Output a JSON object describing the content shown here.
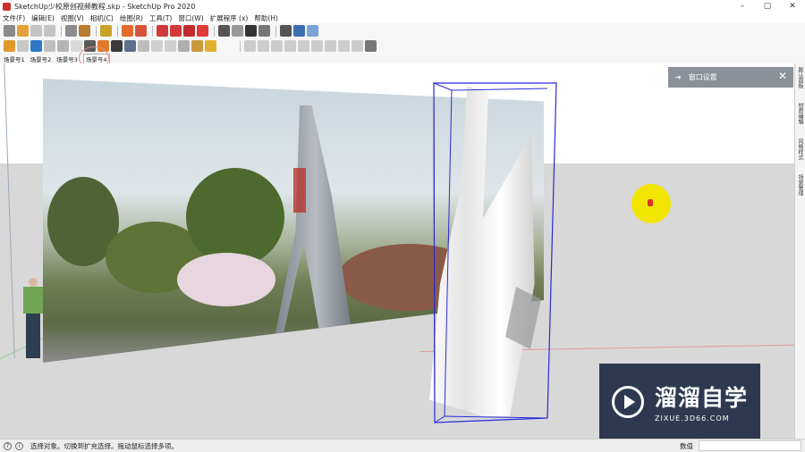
{
  "window": {
    "title": "SketchUp少校原创视频教程.skp - SketchUp Pro 2020",
    "minimize": "–",
    "maximize": "▢",
    "close": "✕"
  },
  "menu": [
    "文件(F)",
    "编辑(E)",
    "视图(V)",
    "相机(C)",
    "绘图(R)",
    "工具(T)",
    "窗口(W)",
    "扩展程序 (x)",
    "帮助(H)"
  ],
  "scene_tabs": [
    "场景号1",
    "场景号2",
    "场景号3",
    "场景号4"
  ],
  "active_tab": "场景号4",
  "tray": {
    "title": "窗口设置",
    "arrow": "➜",
    "close": "✕"
  },
  "right_tabs": [
    "默认面板",
    "材质编辑",
    "风格样式",
    "场景管理"
  ],
  "status": {
    "message": "选择对象。切换到扩充选择。拖动鼠标选择多项。",
    "value_label": "数值",
    "value": ""
  },
  "watermark": {
    "name": "溜溜自学",
    "url": "ZIXUE.3D66.COM"
  },
  "colors": {
    "selection": "#2a2ad8",
    "accent": "#e64c3c",
    "cursor_highlight": "#f2e600"
  }
}
